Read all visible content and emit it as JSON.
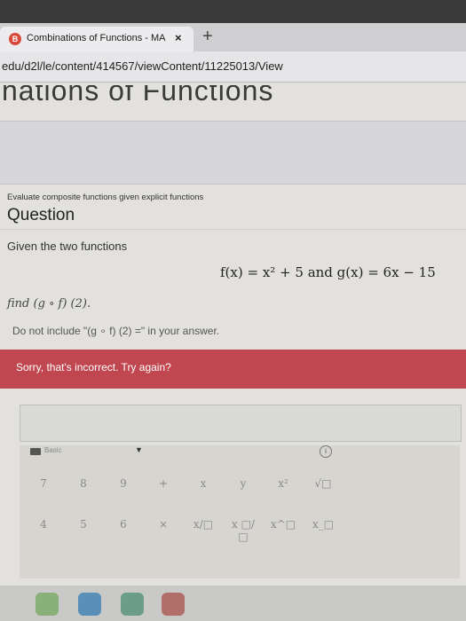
{
  "browser": {
    "tab_title": "Combinations of Functions - MA",
    "tab_favicon": "B",
    "tab_close": "×",
    "new_tab": "+",
    "url": "edu/d2l/le/content/414567/viewContent/11225013/View"
  },
  "page": {
    "cut_heading": "nations of Functions",
    "topic": "Evaluate composite functions given explicit functions",
    "question_title": "Question",
    "given_text": "Given the two functions",
    "formula": "f(x) = x² + 5  and  g(x) = 6x − 15",
    "find_text": "find (g ∘ f) (2).",
    "note_text": "Do not include \"(g ∘ f) (2) =\" in your answer.",
    "feedback": "Sorry, that's incorrect. Try again?"
  },
  "keypad": {
    "mode_label": "Basic",
    "row1": [
      "7",
      "8",
      "9",
      "+",
      "x",
      "y",
      "x²",
      "√□"
    ],
    "row2": [
      "4",
      "5",
      "6",
      "×",
      "x/□",
      "x □/□",
      "x^□",
      "x_□"
    ]
  },
  "colors": {
    "banner": "#c0464f",
    "page_bg": "#e2e1dd"
  },
  "icons": [
    "tab-favicon-icon",
    "close-icon",
    "plus-icon",
    "keyboard-icon",
    "chevron-down-icon",
    "info-icon"
  ]
}
